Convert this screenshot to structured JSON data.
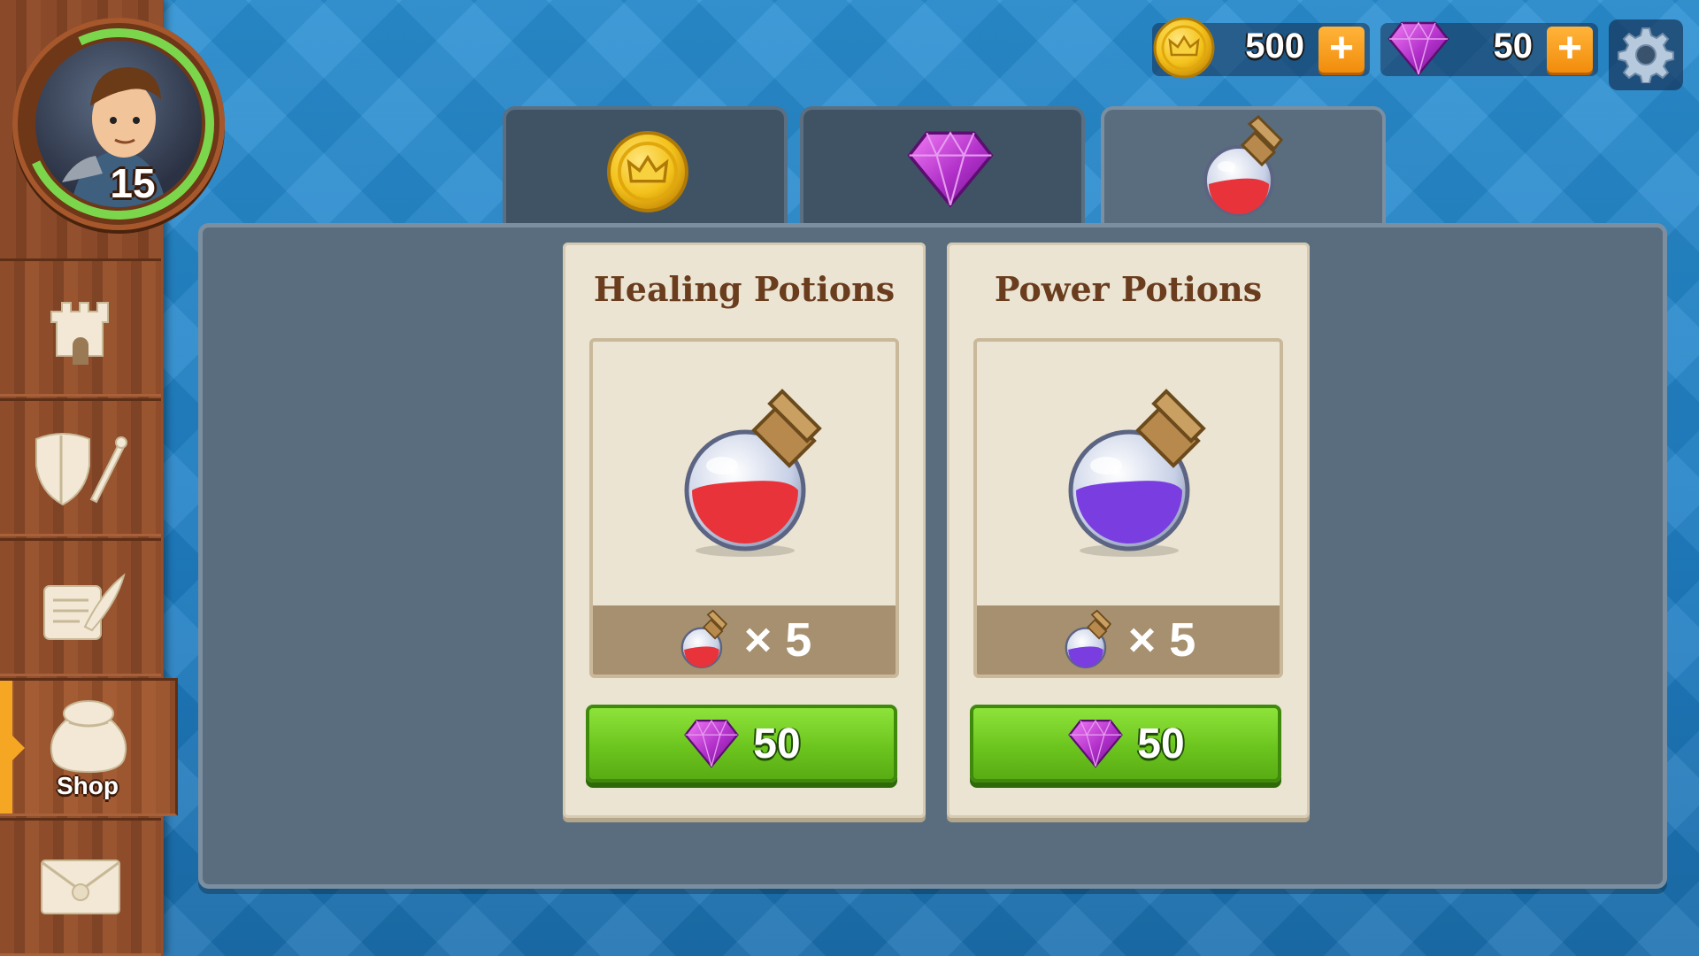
{
  "player": {
    "level": "15",
    "avatar_icon": "hero-portrait-icon",
    "xp_ring_color": "#7cd64c"
  },
  "currencies": {
    "coins": {
      "value": "500",
      "icon": "coin-icon"
    },
    "gems": {
      "value": "50",
      "icon": "gem-icon"
    },
    "plus_label": "+"
  },
  "settings": {
    "icon": "gear-icon"
  },
  "sidebar": {
    "items": [
      {
        "icon": "castle-icon",
        "label": ""
      },
      {
        "icon": "shield-sword-icon",
        "label": ""
      },
      {
        "icon": "scroll-quill-icon",
        "label": ""
      },
      {
        "icon": "loot-bag-icon",
        "label": "Shop",
        "active": true
      },
      {
        "icon": "envelope-icon",
        "label": ""
      }
    ]
  },
  "tabs": [
    {
      "icon": "coin-icon",
      "active": false
    },
    {
      "icon": "gem-icon",
      "active": false
    },
    {
      "icon": "potion-icon",
      "active": true
    }
  ],
  "cards": [
    {
      "title": "Healing Potions",
      "potion_color": "#e8333a",
      "quantity_label": "× 5",
      "price": "50",
      "price_icon": "gem-icon"
    },
    {
      "title": "Power Potions",
      "potion_color": "#7a3ee0",
      "quantity_label": "× 5",
      "price": "50",
      "price_icon": "gem-icon"
    }
  ],
  "colors": {
    "accent_orange": "#f5a623",
    "buy_green": "#6cc51e",
    "gem_purple": "#b02fc9",
    "coin_gold": "#f3c21b"
  }
}
